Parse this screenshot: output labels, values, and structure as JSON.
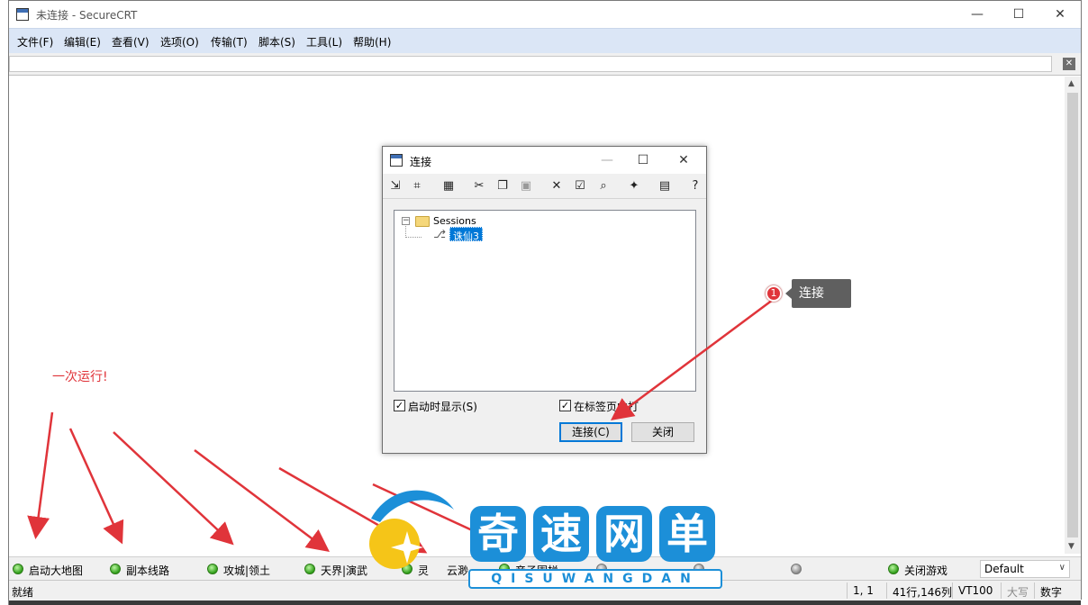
{
  "window": {
    "title": "未连接 - SecureCRT",
    "min": "—",
    "max": "☐",
    "close": "✕"
  },
  "menu": [
    "文件(F)",
    "编辑(E)",
    "查看(V)",
    "选项(O)",
    "传输(T)",
    "脚本(S)",
    "工具(L)",
    "帮助(H)"
  ],
  "command_bar": {
    "value": "",
    "close": "✕"
  },
  "dialog": {
    "title": "连接",
    "min": "—",
    "max": "☐",
    "close": "✕",
    "toolbar_icons": [
      "quick-connect-icon",
      "new-session-icon",
      "new-folder-icon",
      "cut-icon",
      "copy-icon",
      "paste-icon",
      "delete-icon",
      "properties-icon",
      "find-icon",
      "desktop-shortcut-icon",
      "session-manager-icon",
      "help-icon"
    ],
    "tree": {
      "root": "Sessions",
      "expander": "−",
      "sessions": [
        "诛仙3"
      ]
    },
    "show_on_startup": {
      "label": "启动时显示(S)",
      "checked": true
    },
    "open_in_tab": {
      "label": "在标签页中打",
      "checked": true
    },
    "connect_button": "连接(C)",
    "close_button": "关闭"
  },
  "button_bar": {
    "buttons": [
      {
        "label": "启动大地图",
        "active": true
      },
      {
        "label": "副本线路",
        "active": true
      },
      {
        "label": "攻城|领土",
        "active": true
      },
      {
        "label": "天界|演武",
        "active": true
      },
      {
        "label": "灵",
        "active": true
      },
      {
        "label": "云渺",
        "active": true
      },
      {
        "label": "帝子围栏",
        "active": true
      },
      {
        "label": "",
        "active": false
      },
      {
        "label": "",
        "active": false
      },
      {
        "label": "",
        "active": false
      },
      {
        "label": "关闭游戏",
        "active": true
      }
    ],
    "selector": "Default"
  },
  "status_bar": {
    "ready": "就绪",
    "cursor": "1,   1",
    "size": "41行,146列",
    "terminal": "VT100",
    "caps": "大写",
    "num": "数字"
  },
  "annotations": {
    "step_number": "1",
    "callout": "连接",
    "note": "一次运行!",
    "accent": "#e0343a"
  },
  "watermark": {
    "chars": [
      "奇",
      "速",
      "网",
      "单"
    ],
    "pinyin": "QISUWANGDAN",
    "color": "#1c8fd8"
  }
}
